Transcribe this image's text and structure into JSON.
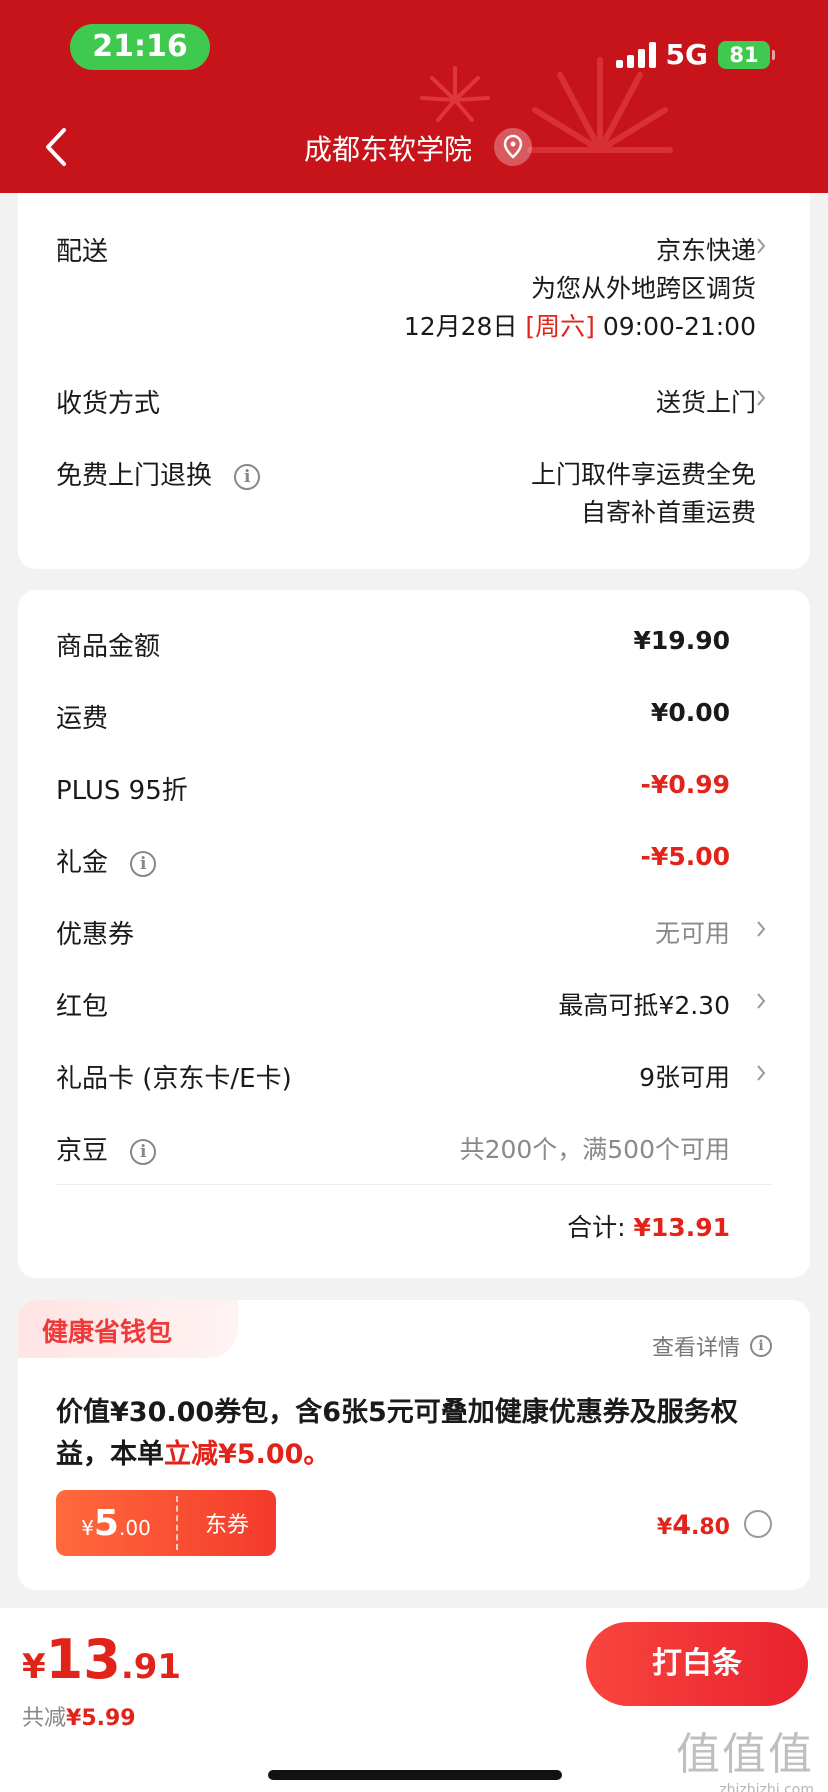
{
  "status_bar": {
    "time": "21:16",
    "network": "5G",
    "battery": "81"
  },
  "header": {
    "title": "成都东软学院"
  },
  "delivery": {
    "label": "配送",
    "carrier": "京东快递",
    "note": "为您从外地跨区调货",
    "date": "12月28日",
    "weekday": "[周六]",
    "time_window": "09:00-21:00"
  },
  "receive_method": {
    "label": "收货方式",
    "value": "送货上门"
  },
  "free_return": {
    "label": "免费上门退换",
    "line1": "上门取件享运费全免",
    "line2": "自寄补首重运费"
  },
  "summary": {
    "goods_amount": {
      "label": "商品金额",
      "value": "¥19.90"
    },
    "shipping": {
      "label": "运费",
      "value": "¥0.00"
    },
    "plus_discount": {
      "label": "PLUS 95折",
      "value": "-¥0.99"
    },
    "gift_money": {
      "label": "礼金",
      "value": "-¥5.00"
    },
    "coupon": {
      "label": "优惠券",
      "value": "无可用"
    },
    "red_packet": {
      "label": "红包",
      "value": "最高可抵¥2.30"
    },
    "gift_card": {
      "label": "礼品卡 (京东卡/E卡)",
      "value": "9张可用"
    },
    "jingdou": {
      "label": "京豆",
      "value": "共200个，满500个可用"
    },
    "total_label": "合计:",
    "total_value": "¥13.91"
  },
  "health_wallet": {
    "title": "健康省钱包",
    "detail": "查看详情",
    "desc_main": "价值¥30.00券包，含6张5元可叠加健康优惠券及服务权益，本单",
    "desc_highlight": "立减¥5.00。",
    "coupon_currency": "¥",
    "coupon_int": "5",
    "coupon_dec": ".00",
    "coupon_type": "东券",
    "price_currency": "¥",
    "price_int": "4",
    "price_dec": ".80"
  },
  "bottom": {
    "currency": "¥",
    "total_int": "13",
    "total_dec": ".91",
    "saved_label": "共减",
    "saved_value": "¥5.99",
    "pay_button": "打白条",
    "watermark": "值值值",
    "watermark_url": "zhizhizhi.com"
  },
  "colors": {
    "header_red": "#c7131a",
    "price_red": "#e2231a",
    "status_green": "#40c94f"
  }
}
